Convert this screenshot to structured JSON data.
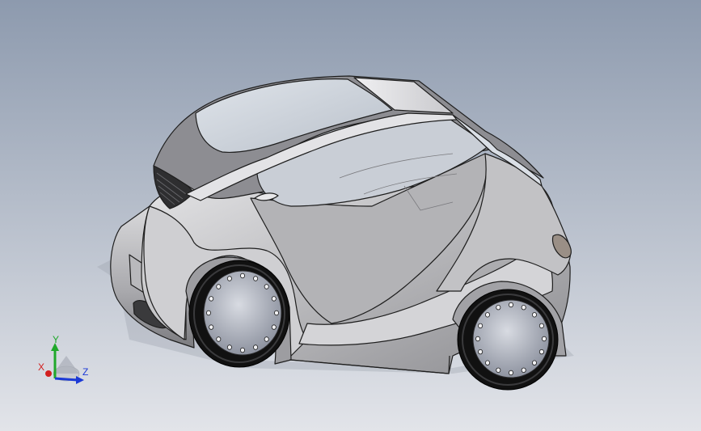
{
  "viewport": {
    "background_top": "#8d9aae",
    "background_bottom": "#e2e4e9"
  },
  "model": {
    "body_color": "#c8c8ca",
    "edge_color": "#1e1e1e",
    "glass_color": "#cfd6de",
    "wheel_color": "#111111",
    "hub_color": "#b6bac4"
  },
  "triad": {
    "x_label": "X",
    "y_label": "Y",
    "z_label": "Z",
    "x_color": "#d21f1f",
    "y_color": "#1fa82a",
    "z_color": "#1c3ad6"
  }
}
